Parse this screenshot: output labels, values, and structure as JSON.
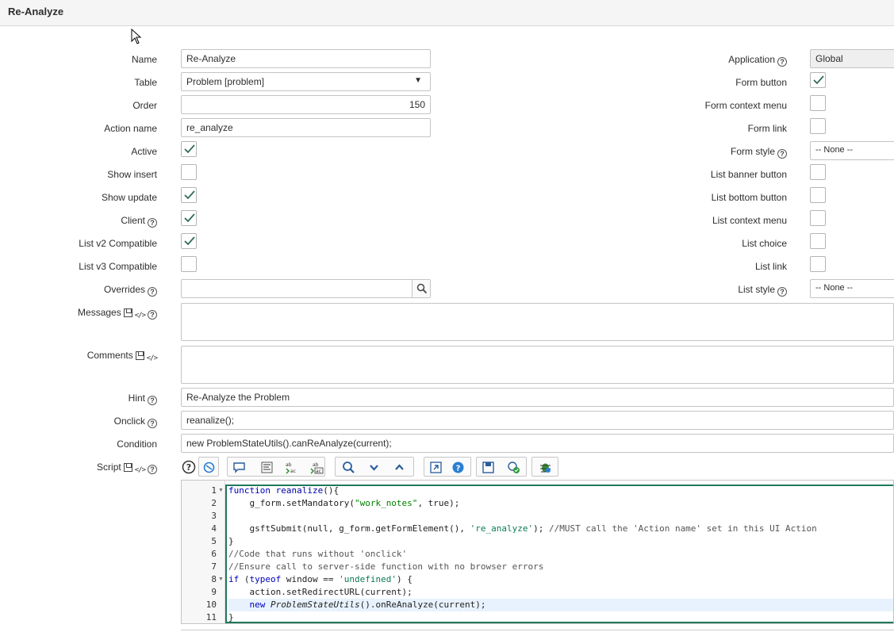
{
  "window": {
    "title": "Re-Analyze"
  },
  "left_fields": {
    "name": {
      "label": "Name",
      "value": "Re-Analyze"
    },
    "table": {
      "label": "Table",
      "value": "Problem [problem]"
    },
    "order": {
      "label": "Order",
      "value": "150"
    },
    "action_name": {
      "label": "Action name",
      "value": "re_analyze"
    },
    "active": {
      "label": "Active",
      "checked": true
    },
    "show_insert": {
      "label": "Show insert",
      "checked": false
    },
    "show_update": {
      "label": "Show update",
      "checked": true
    },
    "client": {
      "label": "Client",
      "checked": true
    },
    "list_v2": {
      "label": "List v2 Compatible",
      "checked": true
    },
    "list_v3": {
      "label": "List v3 Compatible",
      "checked": false
    },
    "overrides": {
      "label": "Overrides",
      "value": ""
    },
    "messages": {
      "label": "Messages",
      "value": ""
    },
    "comments": {
      "label": "Comments",
      "value": ""
    },
    "hint": {
      "label": "Hint",
      "value": "Re-Analyze the Problem"
    },
    "onclick": {
      "label": "Onclick",
      "value": "reanalize();"
    },
    "condition": {
      "label": "Condition",
      "value": "new ProblemStateUtils().canReAnalyze(current);"
    },
    "script": {
      "label": "Script"
    }
  },
  "right_fields": {
    "application": {
      "label": "Application",
      "value": "Global"
    },
    "form_button": {
      "label": "Form button",
      "checked": true
    },
    "form_context_menu": {
      "label": "Form context menu",
      "checked": false
    },
    "form_link": {
      "label": "Form link",
      "checked": false
    },
    "form_style": {
      "label": "Form style",
      "value": "-- None --"
    },
    "list_banner_button": {
      "label": "List banner button",
      "checked": false
    },
    "list_bottom_button": {
      "label": "List bottom button",
      "checked": false
    },
    "list_context_menu": {
      "label": "List context menu",
      "checked": false
    },
    "list_choice": {
      "label": "List choice",
      "checked": false
    },
    "list_link": {
      "label": "List link",
      "checked": false
    },
    "list_style": {
      "label": "List style",
      "value": "-- None --"
    }
  },
  "icons": {
    "help": "?",
    "check": "check-icon",
    "search": "search-icon"
  },
  "script_editor": {
    "toolbar": [
      "help-icon",
      "script-include-icon",
      "comment-icon",
      "format-icon",
      "replace-icon",
      "replace-all-icon",
      "search-icon",
      "expand-icon",
      "collapse-icon",
      "fullscreen-icon",
      "context-help-icon",
      "save-icon",
      "syntax-check-icon",
      "debug-icon"
    ],
    "line_numbers": [
      "1",
      "2",
      "3",
      "4",
      "5",
      "6",
      "7",
      "8",
      "9",
      "10",
      "11"
    ],
    "lines": [
      "function reanalize(){",
      "    g_form.setMandatory(\"work_notes\", true);",
      "",
      "    gsftSubmit(null, g_form.getFormElement(), 're_analyze'); //MUST call the 'Action name' set in this UI Action",
      "}",
      "//Code that runs without 'onclick'",
      "//Ensure call to server-side function with no browser errors",
      "if (typeof window == 'undefined') {",
      "    action.setRedirectURL(current);",
      "    new ProblemStateUtils().onReAnalyze(current);",
      "}"
    ]
  },
  "colors": {
    "accent": "#1f7a5c",
    "check": "#2e6b5b",
    "active_line": "#e8f2fe"
  }
}
